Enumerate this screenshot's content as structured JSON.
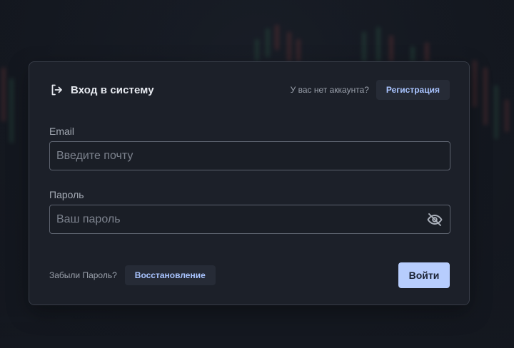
{
  "header": {
    "title": "Вход в систему",
    "login_icon": "login-arrow-icon",
    "no_account_text": "У вас нет аккаунта?",
    "register_label": "Регистрация"
  },
  "form": {
    "email": {
      "label": "Email",
      "placeholder": "Введите почту",
      "value": ""
    },
    "password": {
      "label": "Пароль",
      "placeholder": "Ваш пароль",
      "value": "",
      "toggle_icon": "eye-off-icon"
    }
  },
  "footer": {
    "forgot_text": "Забыли Пароль?",
    "recover_label": "Восстановление",
    "submit_label": "Войти"
  },
  "colors": {
    "accent": "#b7cdfd",
    "link": "#a9c4ff",
    "card_background": "#1c2029",
    "page_background": "#141820"
  }
}
